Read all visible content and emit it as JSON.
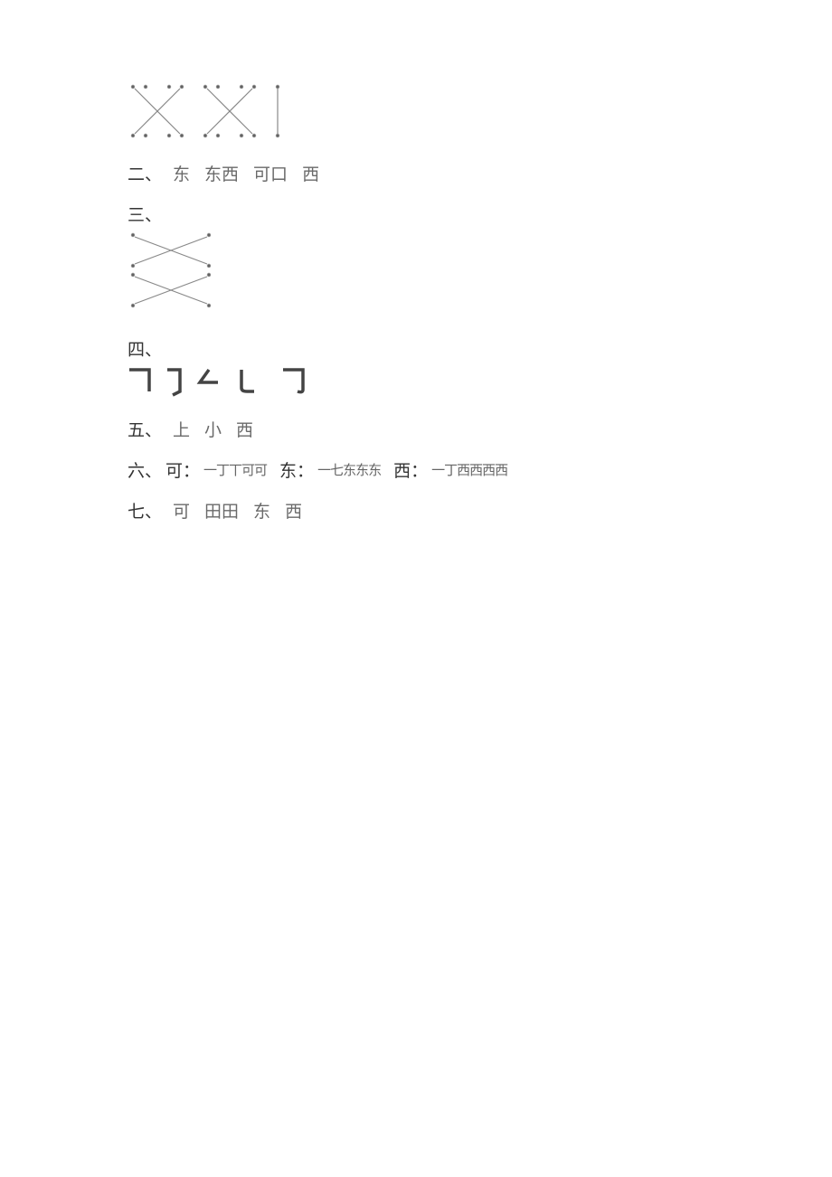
{
  "lines": {
    "two": {
      "label": "二、",
      "parts": [
        "东",
        "东西",
        "可口",
        "西"
      ]
    },
    "three": {
      "label": "三、"
    },
    "four": {
      "label": "四、"
    },
    "five": {
      "label": "五、",
      "parts": [
        "上",
        "小",
        "西"
      ]
    },
    "six": {
      "label": "六、",
      "groups": [
        {
          "label": "可：",
          "strokes": "一丁丅可可"
        },
        {
          "label": "东：",
          "strokes": "一七东东东"
        },
        {
          "label": "西：",
          "strokes": "一丁西西西西"
        }
      ]
    },
    "seven": {
      "label": "七、",
      "parts": [
        "可",
        "田田",
        "东",
        "西"
      ]
    }
  }
}
